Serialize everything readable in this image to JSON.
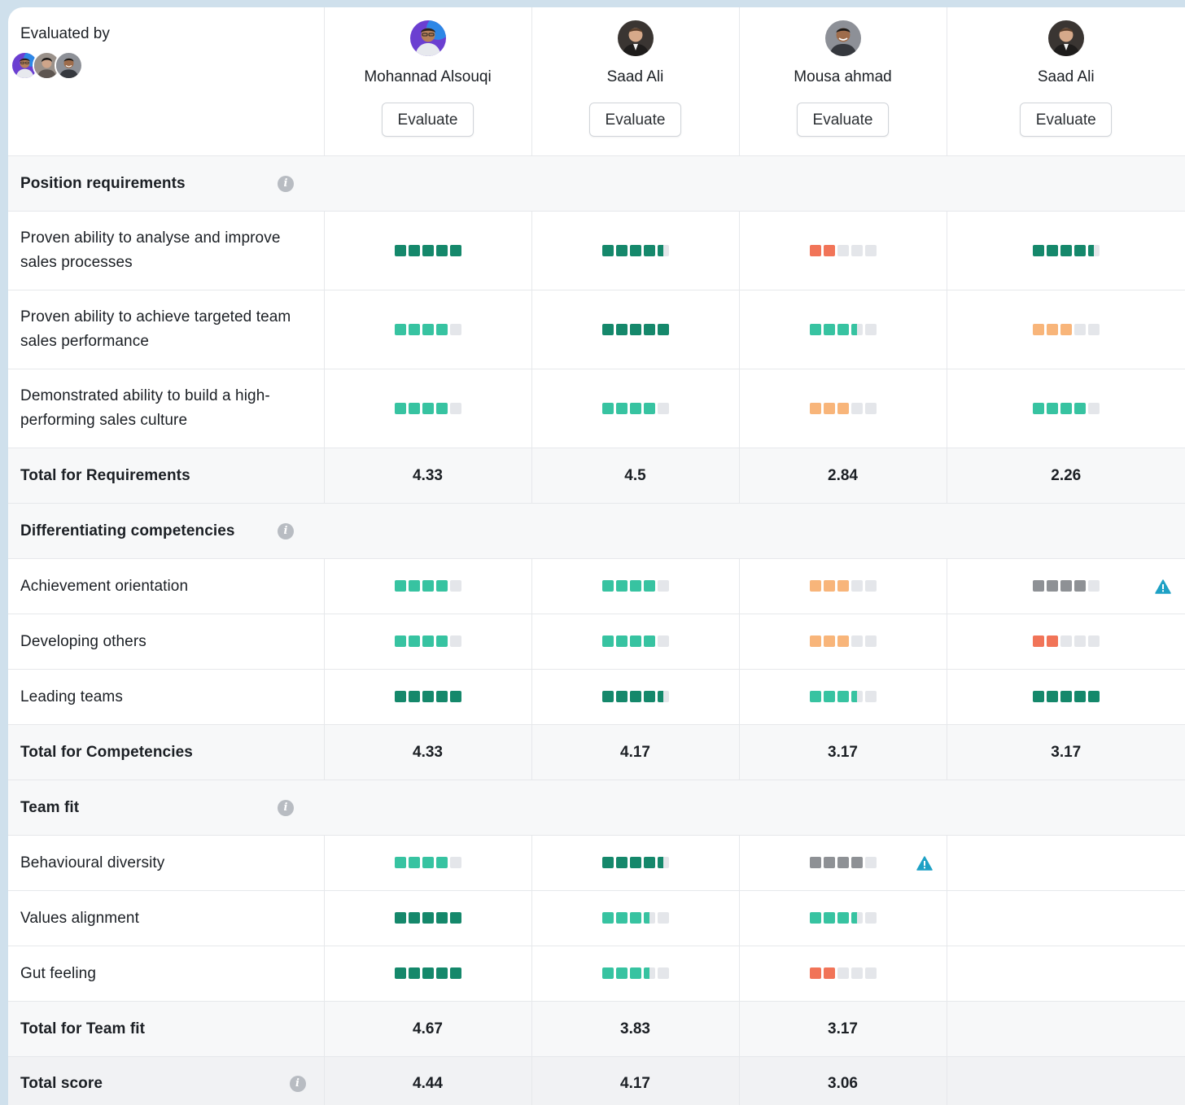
{
  "header": {
    "evaluated_by": "Evaluated by",
    "evaluate_label": "Evaluate"
  },
  "candidates": [
    {
      "name": "Mohannad Alsouqi"
    },
    {
      "name": "Saad Ali"
    },
    {
      "name": "Mousa ahmad"
    },
    {
      "name": "Saad Ali"
    }
  ],
  "colors": {
    "dark_green": "#15886b",
    "green": "#37c3a1",
    "orange": "#f8b57a",
    "red": "#f17458",
    "gray": "#8e9195",
    "empty": "#e4e6ea",
    "warning": "#1ea1c5"
  },
  "sections": [
    {
      "title": "Position requirements",
      "total_label": "Total for Requirements",
      "totals": [
        "4.33",
        "4.5",
        "2.84",
        "2.26"
      ]
    },
    {
      "title": "Differentiating competencies",
      "total_label": "Total for Competencies",
      "totals": [
        "4.33",
        "4.17",
        "3.17",
        "3.17"
      ]
    },
    {
      "title": "Team fit",
      "total_label": "Total for Team fit",
      "totals": [
        "4.67",
        "3.83",
        "3.17",
        ""
      ]
    }
  ],
  "criteria": [
    {
      "label": "Proven ability to analyse and improve sales processes",
      "ratings": [
        {
          "filled": 5,
          "color": "dark_green"
        },
        {
          "filled": 4.5,
          "color": "dark_green"
        },
        {
          "filled": 2,
          "color": "red"
        },
        {
          "filled": 4.5,
          "color": "dark_green"
        }
      ]
    },
    {
      "label": "Proven ability to achieve targeted team sales performance",
      "ratings": [
        {
          "filled": 4,
          "color": "green"
        },
        {
          "filled": 5,
          "color": "dark_green"
        },
        {
          "filled": 3.5,
          "color": "green"
        },
        {
          "filled": 3,
          "color": "orange"
        }
      ]
    },
    {
      "label": "Demonstrated ability to build a high-performing sales culture",
      "ratings": [
        {
          "filled": 4,
          "color": "green"
        },
        {
          "filled": 4,
          "color": "green"
        },
        {
          "filled": 3,
          "color": "orange"
        },
        {
          "filled": 4,
          "color": "green"
        }
      ]
    },
    {
      "label": "Achievement orientation",
      "ratings": [
        {
          "filled": 4,
          "color": "green"
        },
        {
          "filled": 4,
          "color": "green"
        },
        {
          "filled": 3,
          "color": "orange"
        },
        {
          "filled": 4,
          "color": "gray",
          "warning": true
        }
      ]
    },
    {
      "label": "Developing others",
      "ratings": [
        {
          "filled": 4,
          "color": "green"
        },
        {
          "filled": 4,
          "color": "green"
        },
        {
          "filled": 3,
          "color": "orange"
        },
        {
          "filled": 2,
          "color": "red"
        }
      ]
    },
    {
      "label": "Leading teams",
      "ratings": [
        {
          "filled": 5,
          "color": "dark_green"
        },
        {
          "filled": 4.5,
          "color": "dark_green"
        },
        {
          "filled": 3.5,
          "color": "green"
        },
        {
          "filled": 5,
          "color": "dark_green"
        }
      ]
    },
    {
      "label": "Behavioural diversity",
      "ratings": [
        {
          "filled": 4,
          "color": "green"
        },
        {
          "filled": 4.5,
          "color": "dark_green"
        },
        {
          "filled": 4,
          "color": "gray",
          "warning": true
        },
        null
      ]
    },
    {
      "label": "Values alignment",
      "ratings": [
        {
          "filled": 5,
          "color": "dark_green"
        },
        {
          "filled": 3.5,
          "color": "green"
        },
        {
          "filled": 3.5,
          "color": "green"
        },
        null
      ]
    },
    {
      "label": "Gut feeling",
      "ratings": [
        {
          "filled": 5,
          "color": "dark_green"
        },
        {
          "filled": 3.5,
          "color": "green"
        },
        {
          "filled": 2,
          "color": "red"
        },
        null
      ]
    }
  ],
  "total_score": {
    "label": "Total score",
    "values": [
      "4.44",
      "4.17",
      "3.06",
      ""
    ]
  }
}
